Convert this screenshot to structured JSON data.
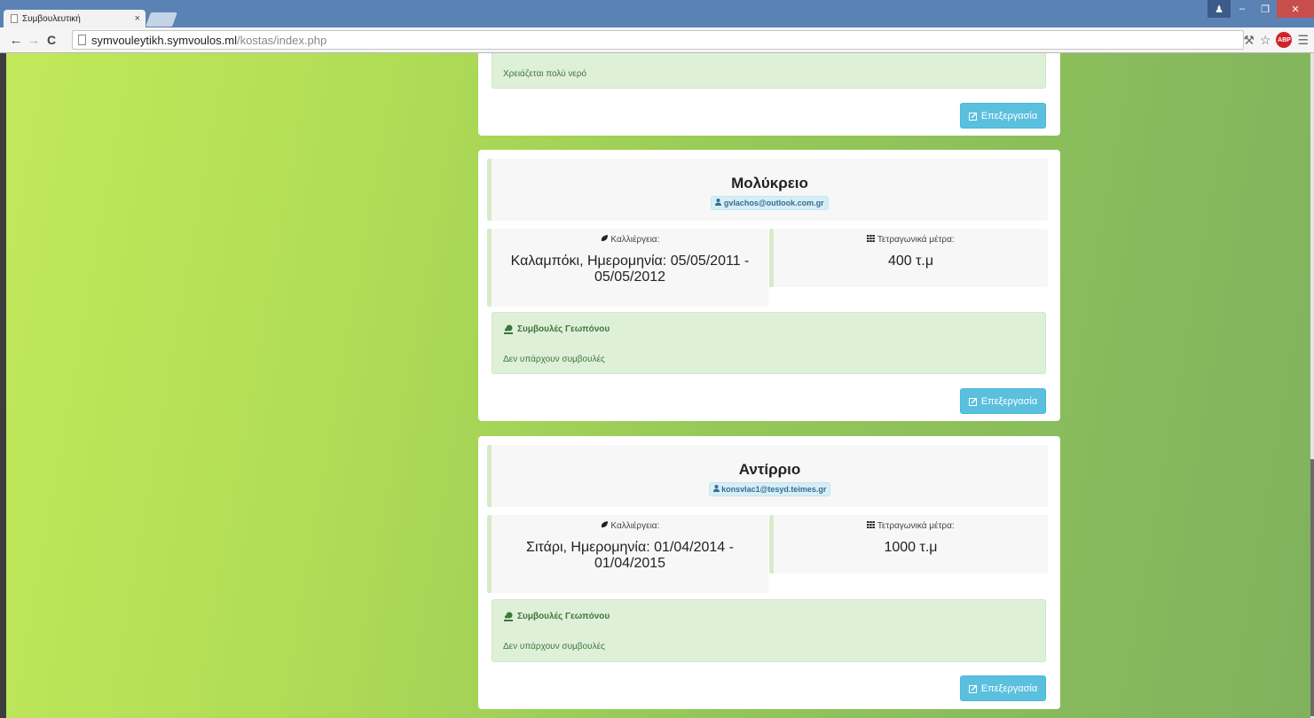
{
  "browser": {
    "tab_title": "Συμβουλευτική",
    "tab_close": "×",
    "url_host": "symvouleytikh.symvoulos.ml",
    "url_path": "/kostas/index.php",
    "back": "←",
    "forward": "→",
    "reload": "C",
    "abp": "ABP"
  },
  "icons": {
    "edit": "pencil-square-icon",
    "crop": "leaf-icon",
    "area": "grid-icon",
    "user": "user-icon",
    "advisor": "advisor-icon"
  },
  "first_card": {
    "advice_text": "Χρειάζεται πολύ νερό",
    "edit_label": "Επεξεργασία"
  },
  "fields": [
    {
      "name": "Μολύκρειο",
      "email": "gvlachos@outlook.com.gr",
      "crop_label": "Καλλιέργεια:",
      "crop_value": "Καλαμπόκι, Ημερομηνία: 05/05/2011 - 05/05/2012",
      "area_label": "Τετραγωνικά μέτρα:",
      "area_value": "400 τ.μ",
      "advice_title": "Συμβουλές Γεωπόνου",
      "advice_text": "Δεν υπάρχουν συμβουλές",
      "edit_label": "Επεξεργασία"
    },
    {
      "name": "Αντίρριο",
      "email": "konsvlac1@tesyd.teimes.gr",
      "crop_label": "Καλλιέργεια:",
      "crop_value": "Σιτάρι, Ημερομηνία: 01/04/2014 - 01/04/2015",
      "area_label": "Τετραγωνικά μέτρα:",
      "area_value": "1000 τ.μ",
      "advice_title": "Συμβουλές Γεωπόνου",
      "advice_text": "Δεν υπάρχουν συμβουλές",
      "edit_label": "Επεξεργασία"
    }
  ],
  "colors": {
    "edit_button": "#5bc0de",
    "advice_bg": "#dff0d8",
    "advice_text": "#3c763d",
    "email_badge_bg": "#d9edf7"
  }
}
